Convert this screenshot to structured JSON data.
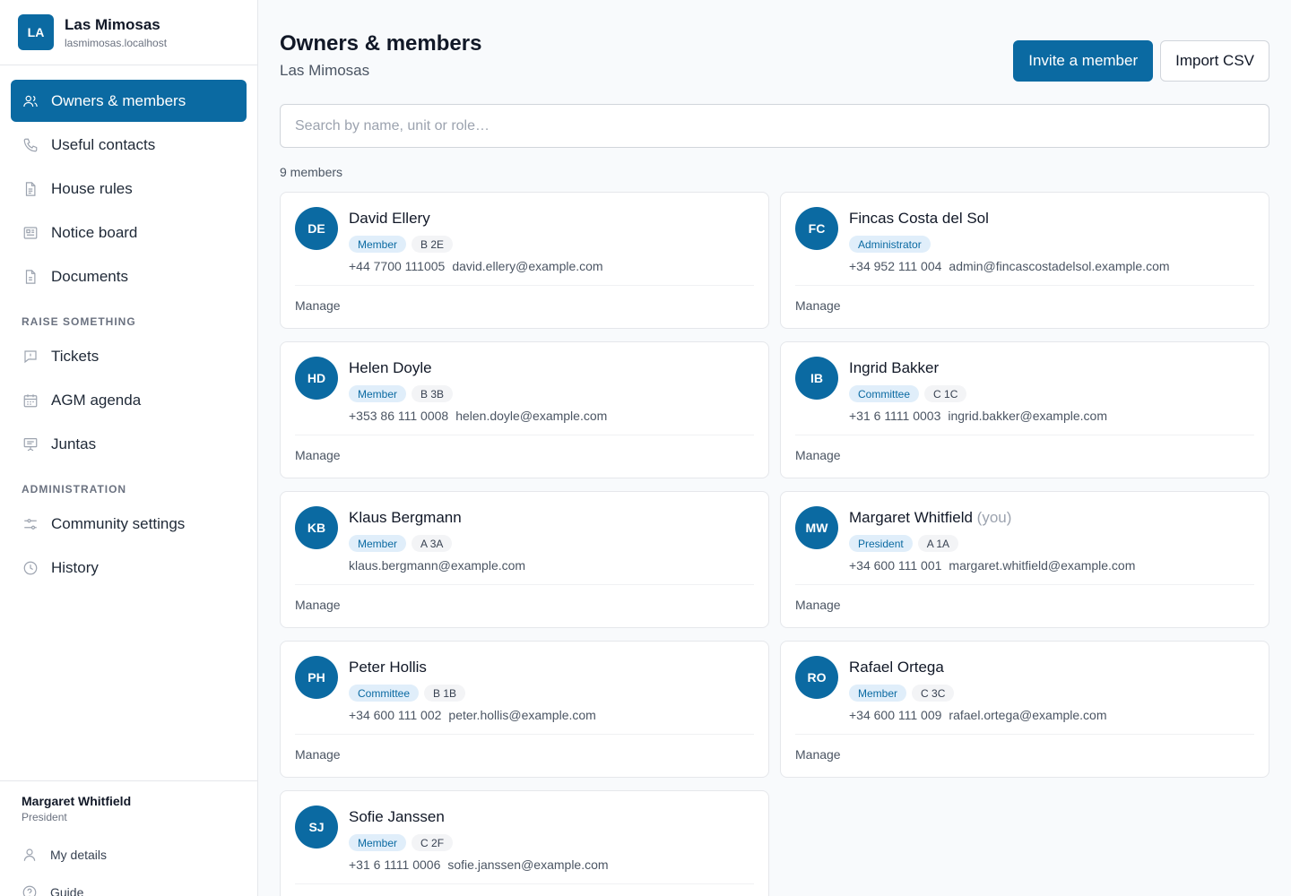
{
  "brand": {
    "initials": "LA",
    "name": "Las Mimosas",
    "host": "lasmimosas.localhost"
  },
  "nav": {
    "items": [
      {
        "label": "Owners & members",
        "icon": "users-icon",
        "active": true
      },
      {
        "label": "Useful contacts",
        "icon": "phone-icon"
      },
      {
        "label": "House rules",
        "icon": "document-icon"
      },
      {
        "label": "Notice board",
        "icon": "noticeboard-icon"
      },
      {
        "label": "Documents",
        "icon": "file-icon"
      }
    ],
    "section_raise": "RAISE SOMETHING",
    "raise_items": [
      {
        "label": "Tickets",
        "icon": "chat-icon"
      },
      {
        "label": "AGM agenda",
        "icon": "calendar-icon"
      },
      {
        "label": "Juntas",
        "icon": "presentation-icon"
      }
    ],
    "section_admin": "ADMINISTRATION",
    "admin_items": [
      {
        "label": "Community settings",
        "icon": "sliders-icon"
      },
      {
        "label": "History",
        "icon": "clock-icon"
      }
    ]
  },
  "user": {
    "name": "Margaret Whitfield",
    "role": "President",
    "links": [
      {
        "label": "My details",
        "icon": "user-icon"
      },
      {
        "label": "Guide",
        "icon": "help-icon"
      }
    ]
  },
  "header": {
    "title": "Owners & members",
    "subtitle": "Las Mimosas",
    "invite_label": "Invite a member",
    "import_label": "Import CSV"
  },
  "search": {
    "placeholder": "Search by name, unit or role…",
    "value": ""
  },
  "count_label": "9 members",
  "manage_label": "Manage",
  "members": [
    {
      "initials": "DE",
      "name": "David Ellery",
      "you": "",
      "role": "Member",
      "unit": "B 2E",
      "phone": "+44 7700 111005",
      "email": "david.ellery@example.com"
    },
    {
      "initials": "FC",
      "name": "Fincas Costa del Sol",
      "you": "",
      "role": "Administrator",
      "unit": "",
      "phone": "+34 952 111 004",
      "email": "admin@fincascostadelsol.example.com"
    },
    {
      "initials": "HD",
      "name": "Helen Doyle",
      "you": "",
      "role": "Member",
      "unit": "B 3B",
      "phone": "+353 86 111 0008",
      "email": "helen.doyle@example.com"
    },
    {
      "initials": "IB",
      "name": "Ingrid Bakker",
      "you": "",
      "role": "Committee",
      "unit": "C 1C",
      "phone": "+31 6 1111 0003",
      "email": "ingrid.bakker@example.com"
    },
    {
      "initials": "KB",
      "name": "Klaus Bergmann",
      "you": "",
      "role": "Member",
      "unit": "A 3A",
      "phone": "",
      "email": "klaus.bergmann@example.com"
    },
    {
      "initials": "MW",
      "name": "Margaret Whitfield",
      "you": "(you)",
      "role": "President",
      "unit": "A 1A",
      "phone": "+34 600 111 001",
      "email": "margaret.whitfield@example.com"
    },
    {
      "initials": "PH",
      "name": "Peter Hollis",
      "you": "",
      "role": "Committee",
      "unit": "B 1B",
      "phone": "+34 600 111 002",
      "email": "peter.hollis@example.com"
    },
    {
      "initials": "RO",
      "name": "Rafael Ortega",
      "you": "",
      "role": "Member",
      "unit": "C 3C",
      "phone": "+34 600 111 009",
      "email": "rafael.ortega@example.com"
    },
    {
      "initials": "SJ",
      "name": "Sofie Janssen",
      "you": "",
      "role": "Member",
      "unit": "C 2F",
      "phone": "+31 6 1111 0006",
      "email": "sofie.janssen@example.com"
    }
  ],
  "colors": {
    "accent": "#0b6aa2",
    "role_badge_bg": "#e0eefa",
    "unit_badge_bg": "#f3f4f6"
  }
}
